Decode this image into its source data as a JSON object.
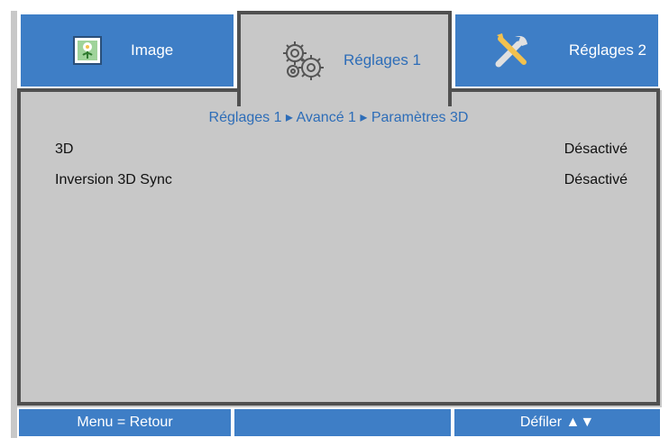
{
  "tabs": [
    {
      "label": "Image",
      "icon": "image-icon"
    },
    {
      "label": "Réglages 1",
      "icon": "gears-icon"
    },
    {
      "label": "Réglages 2",
      "icon": "tools-icon"
    }
  ],
  "breadcrumb": "Réglages 1 ▸ Avancé 1 ▸ Paramètres 3D",
  "settings": [
    {
      "label": "3D",
      "value": "Désactivé"
    },
    {
      "label": "Inversion 3D Sync",
      "value": "Désactivé"
    }
  ],
  "footer": {
    "left": "Menu = Retour",
    "middle": "",
    "right": "Défiler ▲▼"
  },
  "colors": {
    "accent": "#3e7ec6",
    "panel": "#c8c8c8",
    "border": "#505050",
    "text_active": "#2d6db8"
  }
}
